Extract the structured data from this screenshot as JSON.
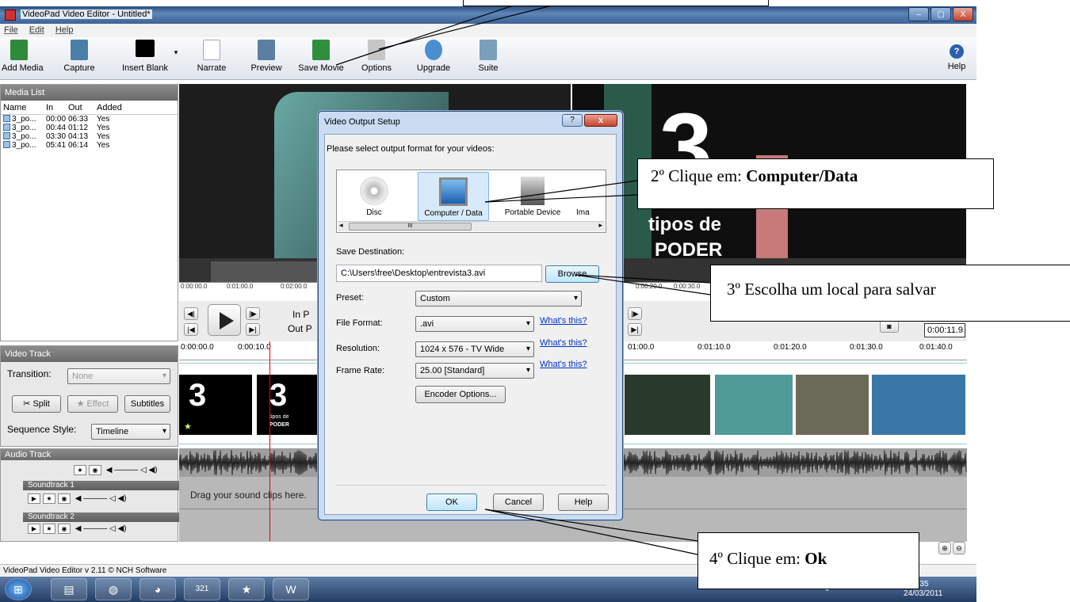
{
  "window": {
    "title": "VideoPad Video Editor - Untitled*",
    "min": "–",
    "max": "▢",
    "close": "X"
  },
  "menu": [
    "File",
    "Edit",
    "Help"
  ],
  "toolbar": [
    {
      "label": "Add Media",
      "icon": "add-media-icon",
      "color": "#2e8b3a"
    },
    {
      "label": "Capture",
      "icon": "capture-icon",
      "color": "#4a7fa8"
    },
    {
      "label": "Insert Blank",
      "icon": "insert-blank-icon",
      "color": "#000000"
    },
    {
      "label": "Narrate",
      "icon": "narrate-icon",
      "color": "#cfd6e0"
    },
    {
      "label": "Preview",
      "icon": "preview-icon",
      "color": "#5b7fa0"
    },
    {
      "label": "Save Movie",
      "icon": "save-movie-icon",
      "color": "#2f8f3f"
    },
    {
      "label": "Options",
      "icon": "options-icon",
      "color": "#c6c6c6"
    },
    {
      "label": "Upgrade",
      "icon": "upgrade-icon",
      "color": "#4a8fd0"
    },
    {
      "label": "Suite",
      "icon": "suite-icon",
      "color": "#7a9fb8"
    }
  ],
  "help_label": "Help",
  "media_list": {
    "title": "Media List",
    "columns": [
      "Name",
      "In",
      "Out",
      "Added"
    ],
    "rows": [
      [
        "3_po...",
        "00:00",
        "06:33",
        "Yes"
      ],
      [
        "3_po...",
        "00:44",
        "01:12",
        "Yes"
      ],
      [
        "3_po...",
        "03:30",
        "04:13",
        "Yes"
      ],
      [
        "3_po...",
        "05:41",
        "06:14",
        "Yes"
      ]
    ]
  },
  "preview": {
    "ruler_left": [
      "0:00:00.0",
      "0:01:00.0",
      "0:02:00.0"
    ],
    "ruler_right": [
      "0:00:20.0",
      "0:00:30.0"
    ],
    "in_label": "In P",
    "out_label": "Out P",
    "time_display": "0:00:11.9",
    "overlay_big": "3",
    "overlay_text1": "tipos de",
    "overlay_text2": "PODER"
  },
  "video_track": {
    "title": "Video Track",
    "transition_label": "Transition:",
    "transition_value": "None",
    "split": "Split",
    "effect": "Effect",
    "subtitles": "Subtitles",
    "sequence_label": "Sequence Style:",
    "sequence_value": "Timeline"
  },
  "timeline": {
    "ticks_left": [
      "0:00:00.0",
      "0:00:10.0"
    ],
    "ticks_right": [
      "01:00.0",
      "0:01:10.0",
      "0:01:20.0",
      "0:01:30.0",
      "0:01:40.0"
    ],
    "clip1_text": "3",
    "clip2_text": "3",
    "clip2_sub1": "tipos de",
    "clip2_sub2": "PODER"
  },
  "audio": {
    "title": "Audio Track",
    "soundtrack1": "Soundtrack 1",
    "soundtrack2": "Soundtrack 2",
    "drag_hint": "Drag your sound clips here."
  },
  "status": {
    "text": "VideoPad Video Editor v 2.11 © NCH Software"
  },
  "taskbar": {
    "clock_time": ":35",
    "clock_date": "24/03/2011",
    "calendar_day": "321"
  },
  "dialog": {
    "title": "Video Output Setup",
    "help_btn": "?",
    "close_btn": "x",
    "prompt": "Please select output format for your videos:",
    "formats": [
      "Disc",
      "Computer / Data",
      "Portable Device",
      "Ima"
    ],
    "scroll_mark": "III",
    "save_dest_label": "Save Destination:",
    "save_dest_value": "C:\\Users\\free\\Desktop\\entrevista3.avi",
    "browse": "Browse",
    "preset_label": "Preset:",
    "preset_value": "Custom",
    "file_format_label": "File Format:",
    "file_format_value": ".avi",
    "resolution_label": "Resolution:",
    "resolution_value": "1024 x 576 - TV Wide",
    "frame_rate_label": "Frame Rate:",
    "frame_rate_value": "25.00 [Standard]",
    "whats_this": "What's this?",
    "encoder_options": "Encoder Options...",
    "ok": "OK",
    "cancel": "Cancel",
    "help": "Help"
  },
  "callouts": {
    "step2_prefix": "2º Clique em: ",
    "step2_bold": "Computer/Data",
    "step3": "3º Escolha um local para salvar",
    "step4_prefix": "4º Clique em: ",
    "step4_bold": "Ok"
  },
  "colors": {
    "accent": "#1f3c68",
    "dialog_frame": "#c9dcf1",
    "link": "#0033cc",
    "playhead": "#ee0000"
  }
}
